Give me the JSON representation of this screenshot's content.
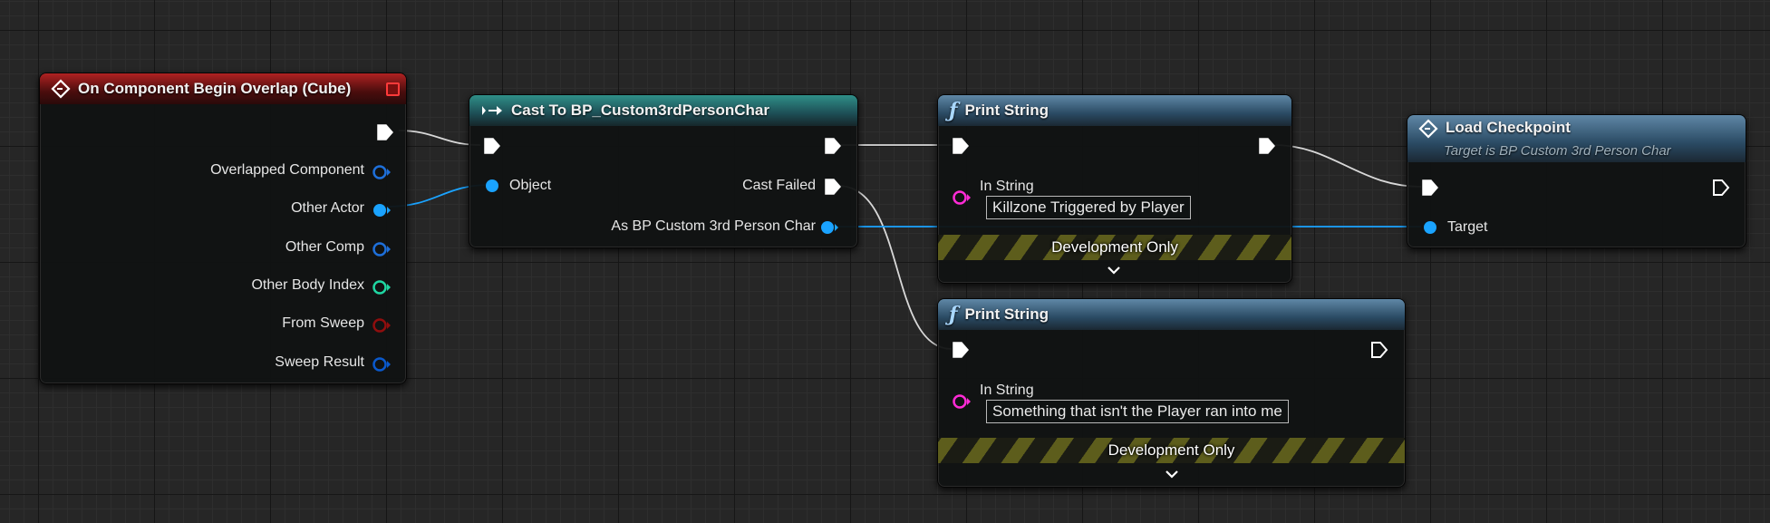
{
  "nodes": {
    "overlap_event": {
      "title": "On Component Begin Overlap (Cube)",
      "pins": {
        "overlapped_component": "Overlapped Component",
        "other_actor": "Other Actor",
        "other_comp": "Other Comp",
        "other_body_index": "Other Body Index",
        "from_sweep": "From Sweep",
        "sweep_result": "Sweep Result"
      }
    },
    "cast": {
      "title": "Cast To BP_Custom3rdPersonChar",
      "pins": {
        "object": "Object",
        "cast_failed": "Cast Failed",
        "as_bp": "As BP Custom 3rd Person Char"
      }
    },
    "print_string_1": {
      "title": "Print String",
      "in_string_label": "In String",
      "in_string_value": "Killzone Triggered by Player",
      "dev_only": "Development Only"
    },
    "print_string_2": {
      "title": "Print String",
      "in_string_label": "In String",
      "in_string_value": "Something that isn't the Player ran into me",
      "dev_only": "Development Only"
    },
    "load_checkpoint": {
      "title": "Load Checkpoint",
      "subtitle": "Target is BP Custom 3rd Person Char",
      "target_label": "Target"
    }
  },
  "colors": {
    "exec_wire": "#d8d8d8",
    "object_pin": "#1aa3ff",
    "component_pin": "#1e6fd9",
    "integer_pin": "#1fd6a2",
    "boolean_pin": "#8f0e0e",
    "struct_pin": "#0a59cc",
    "string_pin": "#ff2bd6",
    "event_header": "#b02222",
    "cast_header": "#2f8f88",
    "function_header": "#5f87a6"
  },
  "icons": {
    "event": "event-diamond-icon",
    "cast": "cast-arrows-icon",
    "function": "function-f-icon",
    "exec": "exec-pin-icon",
    "expand": "chevron-down-icon"
  }
}
